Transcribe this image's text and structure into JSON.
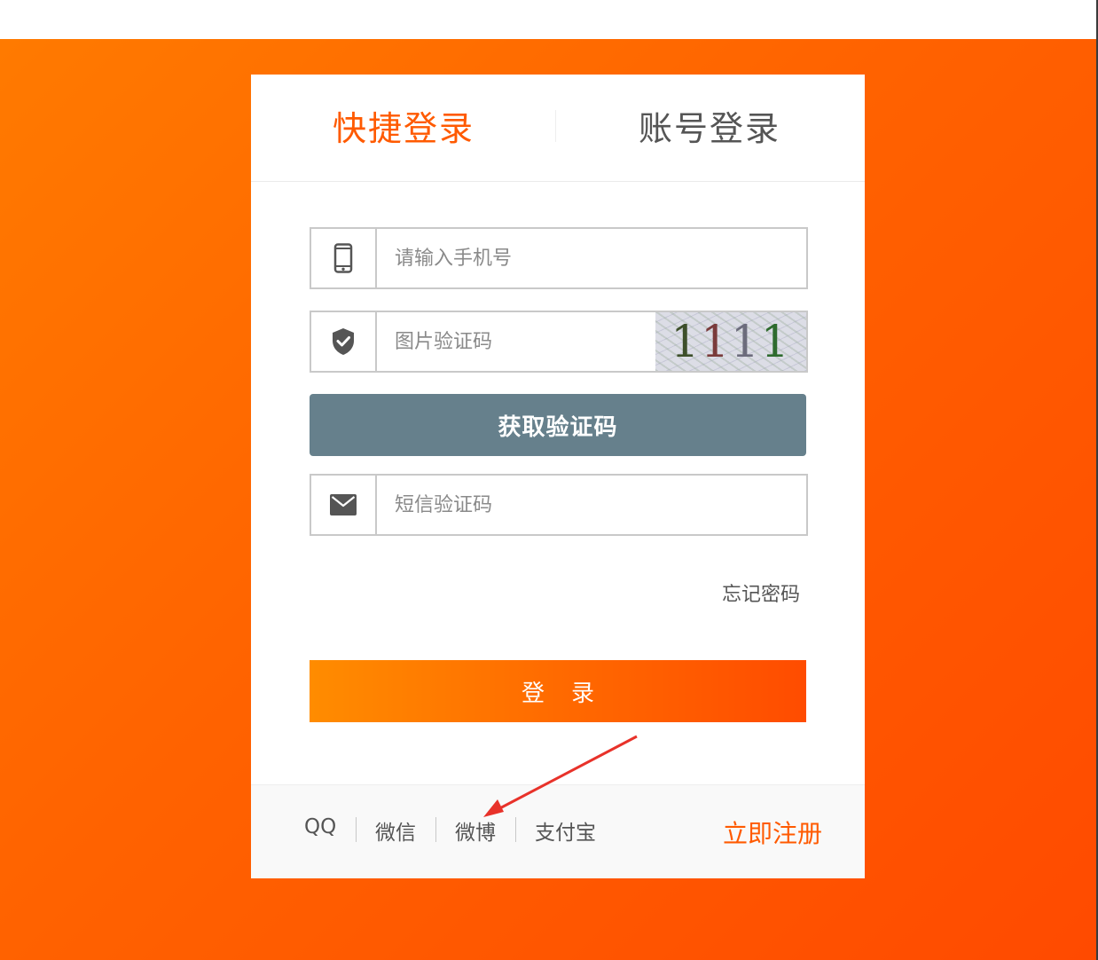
{
  "tabs": {
    "quick_login": "快捷登录",
    "account_login": "账号登录"
  },
  "form": {
    "phone_placeholder": "请输入手机号",
    "captcha_placeholder": "图片验证码",
    "captcha_digits": [
      "1",
      "1",
      "1",
      "1"
    ],
    "get_code_label": "获取验证码",
    "sms_placeholder": "短信验证码",
    "forgot_password": "忘记密码",
    "login_label": "登录"
  },
  "footer": {
    "social": [
      "QQ",
      "微信",
      "微博",
      "支付宝"
    ],
    "register": "立即注册"
  },
  "icons": {
    "phone": "phone-icon",
    "captcha": "shield-check-icon",
    "sms": "mail-icon"
  },
  "colors": {
    "accent": "#ff5a00",
    "get_code_button": "#66808c",
    "background_start": "#ff7a00",
    "background_end": "#ff4a00"
  }
}
